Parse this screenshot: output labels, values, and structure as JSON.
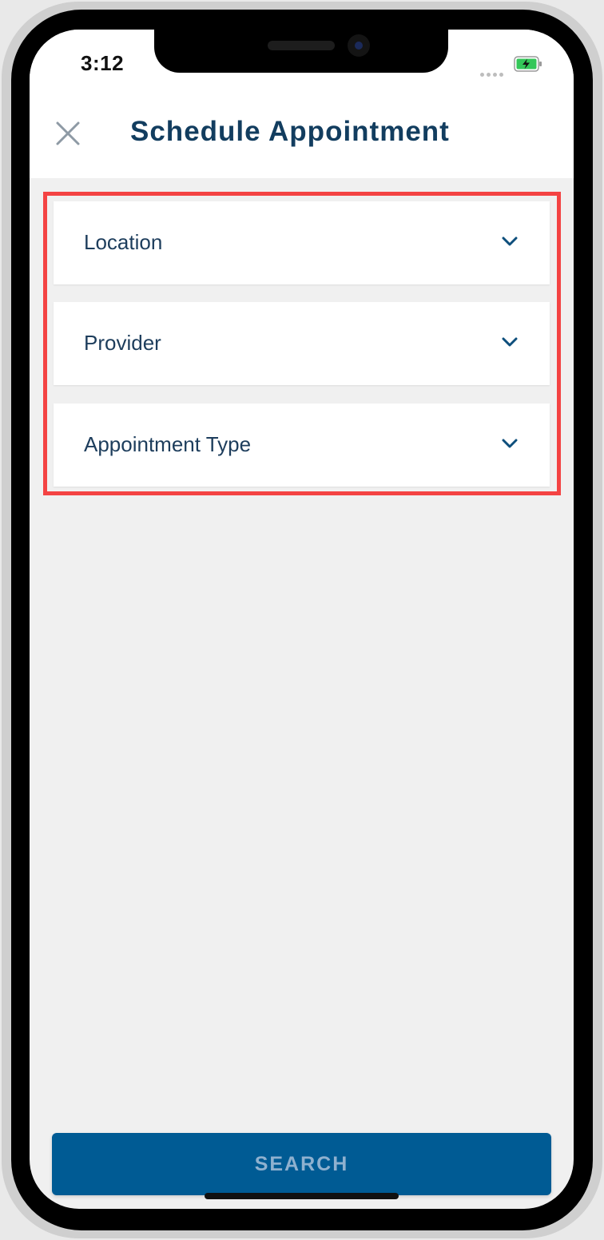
{
  "status_bar": {
    "time": "3:12"
  },
  "header": {
    "title": "Schedule Appointment",
    "close_icon": "close-icon"
  },
  "form": {
    "dropdowns": [
      {
        "label": "Location",
        "icon": "chevron-down-icon"
      },
      {
        "label": "Provider",
        "icon": "chevron-down-icon"
      },
      {
        "label": "Appointment Type",
        "icon": "chevron-down-icon"
      }
    ]
  },
  "actions": {
    "search_label": "SEARCH"
  },
  "colors": {
    "title": "#123d5f",
    "highlight": "#f44343",
    "button_bg": "#005b94",
    "button_text": "#8fb1cf",
    "battery": "#34c759"
  }
}
